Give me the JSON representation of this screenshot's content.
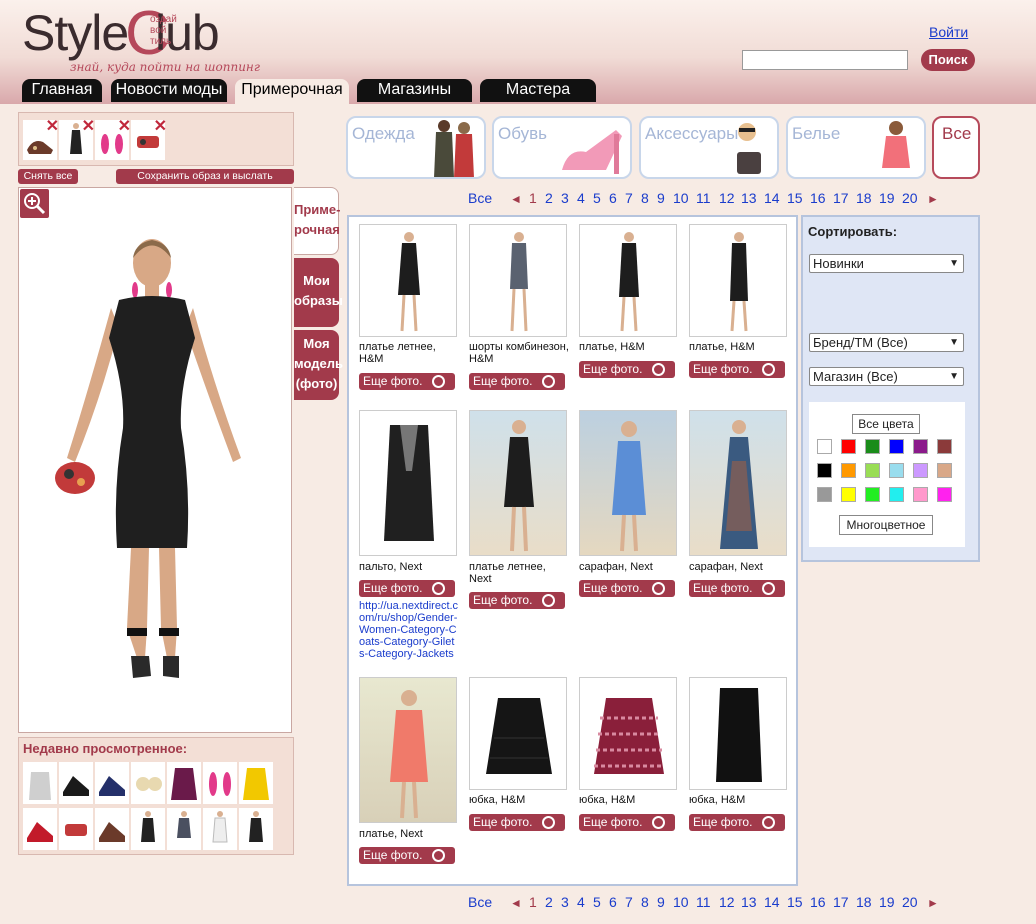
{
  "header": {
    "logo_text_style": "Style",
    "logo_text_c": "C",
    "logo_text_lub": "lub",
    "logo_small": "оздай вой тиль",
    "tagline": "знай, куда пойти на шоппинг",
    "login_link": "Войти",
    "search_placeholder": "",
    "search_button": "Поиск"
  },
  "nav": {
    "tabs": [
      {
        "label": "Главная"
      },
      {
        "label": "Новости моды"
      },
      {
        "label": "Примерочная"
      },
      {
        "label": "Магазины"
      },
      {
        "label": "Мастера"
      }
    ]
  },
  "fitting": {
    "remove_all": "Снять все",
    "save_and_send": "Сохранить образ и выслать друзьям",
    "side_tabs": [
      {
        "label": "Приме-рочная"
      },
      {
        "label": "Мои образы"
      },
      {
        "label": "Моя модель (фото)"
      }
    ]
  },
  "recent": {
    "title": "Недавно просмотренное:"
  },
  "categories": [
    {
      "label": "Одежда"
    },
    {
      "label": "Обувь"
    },
    {
      "label": "Аксессуары"
    },
    {
      "label": "Белье"
    },
    {
      "label": "Все"
    }
  ],
  "pagination": {
    "all": "Все",
    "pages": [
      "1",
      "2",
      "3",
      "4",
      "5",
      "6",
      "7",
      "8",
      "9",
      "10",
      "11",
      "12",
      "13",
      "14",
      "15",
      "16",
      "17",
      "18",
      "19",
      "20"
    ],
    "prev": "◄",
    "next": "►"
  },
  "products": [
    {
      "name": "платье летнее, H&M",
      "button": "Еще фото."
    },
    {
      "name": "шорты комбинезон, H&M",
      "button": "Еще фото."
    },
    {
      "name": "платье, H&M",
      "button": "Еще фото."
    },
    {
      "name": "платье, H&M",
      "button": "Еще фото."
    },
    {
      "name": "пальто, Next",
      "button": "Еще фото.",
      "link": "http://ua.nextdirect.com/ru/shop/Gender-Women-Category-Coats-Category-Gilets-Category-Jackets"
    },
    {
      "name": "платье летнее, Next",
      "button": "Еще фото."
    },
    {
      "name": "сарафан, Next",
      "button": "Еще фото."
    },
    {
      "name": "сарафан, Next",
      "button": "Еще фото."
    },
    {
      "name": "платье, Next",
      "button": "Еще фото."
    },
    {
      "name": "юбка, H&M",
      "button": "Еще фото."
    },
    {
      "name": "юбка, H&M",
      "button": "Еще фото."
    },
    {
      "name": "юбка, H&M",
      "button": "Еще фото."
    }
  ],
  "filters": {
    "sort_label": "Сортировать:",
    "sort_value": "Новинки",
    "brand_value": "Бренд/ТМ (Все)",
    "shop_value": "Магазин (Все)",
    "all_colors": "Все цвета",
    "multicolor": "Многоцветное",
    "swatches": [
      "#ffffff",
      "#ff0000",
      "#1a8c1a",
      "#0000ff",
      "#8b1a8b",
      "#8b3a3a",
      "#000000",
      "#ff9900",
      "#99dd55",
      "#99ddee",
      "#cc99ff",
      "#d9a888",
      "#999999",
      "#ffff00",
      "#22ee22",
      "#22eeee",
      "#ff99cc",
      "#ff22ee"
    ]
  },
  "colors": {
    "accent": "#a23a4b",
    "link": "#1a3ccc",
    "panel_blue": "#dfe6f5"
  }
}
